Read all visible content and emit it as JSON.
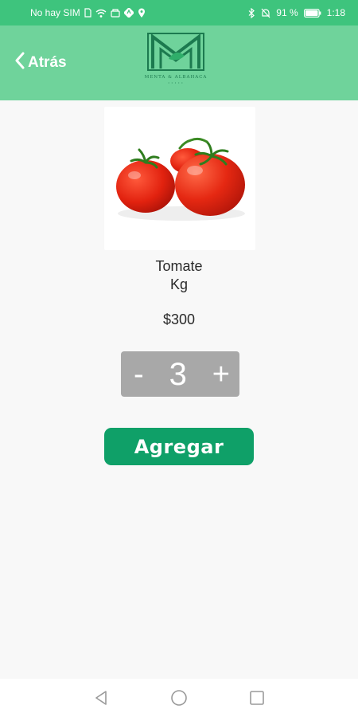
{
  "status_bar": {
    "carrier": "No hay SIM",
    "battery": "91 %",
    "time": "1:18",
    "icons": [
      "sim-icon",
      "wifi-icon",
      "data-saver-icon",
      "navigation-icon",
      "location-icon",
      "bluetooth-icon",
      "mute-icon",
      "battery-icon"
    ]
  },
  "header": {
    "back_label": "Atrás",
    "logo_name": "MENTA & ALBAHACA"
  },
  "product": {
    "name": "Tomate",
    "unit": "Kg",
    "price": "$300",
    "image": "tomato-photo"
  },
  "stepper": {
    "minus": "-",
    "quantity": "3",
    "plus": "+"
  },
  "actions": {
    "add_label": "Agregar"
  },
  "nav": {
    "icons": [
      "back-triangle-icon",
      "home-circle-icon",
      "recents-square-icon"
    ]
  },
  "colors": {
    "status_bar": "#3ec47d",
    "header": "#6fd39b",
    "add_button": "#0fa068",
    "stepper": "#a8a8a8",
    "logo": "#1c7a4f"
  }
}
